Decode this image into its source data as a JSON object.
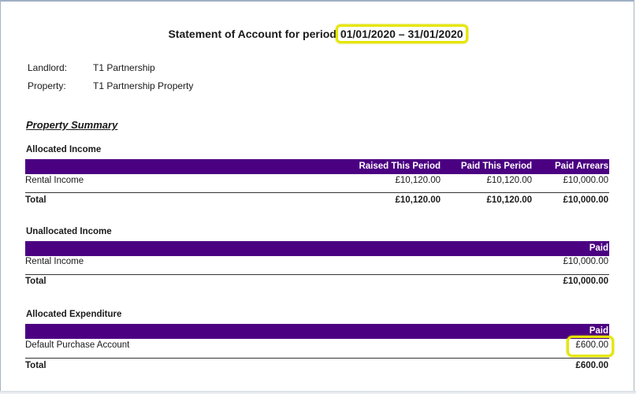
{
  "title": {
    "prefix": "Statement of Account for period",
    "period": "01/01/2020 – 31/01/2020"
  },
  "meta": {
    "landlord_label": "Landlord:",
    "landlord_value": "T1 Partnership",
    "property_label": "Property:",
    "property_value": "T1 Partnership Property"
  },
  "summary_title": "Property Summary",
  "allocated_income": {
    "title": "Allocated Income",
    "headers": [
      "Raised This Period",
      "Paid This Period",
      "Paid Arrears"
    ],
    "row": {
      "label": "Rental Income",
      "values": [
        "£10,120.00",
        "£10,120.00",
        "£10,000.00"
      ]
    },
    "total": {
      "label": "Total",
      "values": [
        "£10,120.00",
        "£10,120.00",
        "£10,000.00"
      ]
    }
  },
  "unallocated_income": {
    "title": "Unallocated Income",
    "header": "Paid",
    "row": {
      "label": "Rental Income",
      "value": "£10,000.00"
    },
    "total": {
      "label": "Total",
      "value": "£10,000.00"
    }
  },
  "allocated_expenditure": {
    "title": "Allocated Expenditure",
    "header": "Paid",
    "row": {
      "label": "Default Purchase Account",
      "value": "£600.00"
    },
    "total": {
      "label": "Total",
      "value": "£600.00"
    }
  },
  "colors": {
    "header_bg": "#4b0082",
    "highlight": "#e5e600"
  }
}
